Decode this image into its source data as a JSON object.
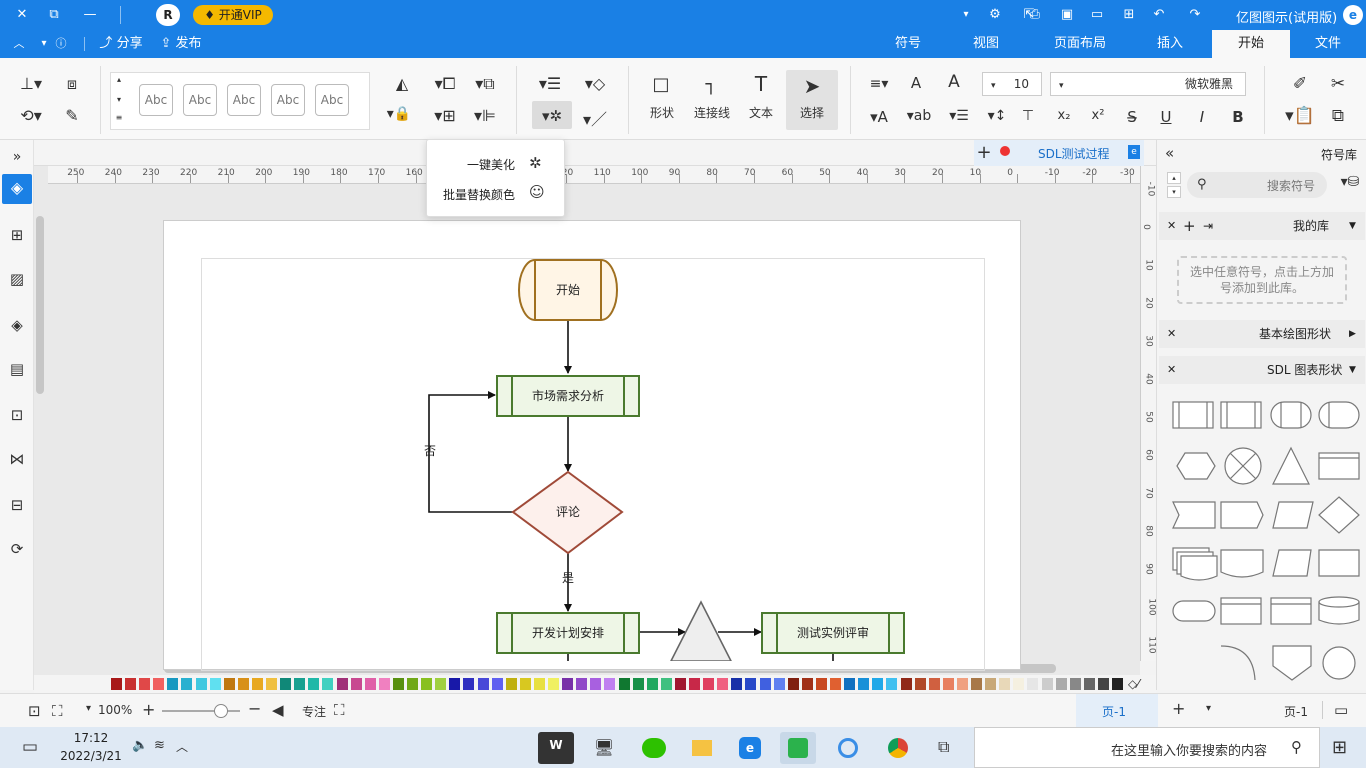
{
  "app": {
    "title": "亿图图示(试用版)"
  },
  "vip": {
    "label": "开通VIP",
    "avatar": "R"
  },
  "tabs": [
    "文件",
    "开始",
    "插入",
    "页面布局",
    "视图",
    "符号"
  ],
  "quick": {
    "share": "分享",
    "publish": "发布",
    "help": "?"
  },
  "ribbon": {
    "font_name": "微软雅黑",
    "font_size": "10",
    "select": "选择",
    "text": "文本",
    "connector": "连接线",
    "shape": "形状",
    "abc": "Abc"
  },
  "dropdown": {
    "items": [
      "一键美化",
      "批量替换颜色"
    ]
  },
  "doc_tab": {
    "name": "SDL测试过程"
  },
  "ruler": {
    "h_ticks": [
      "-30",
      "-20",
      "-10",
      "0",
      "10",
      "20",
      "30",
      "40",
      "50",
      "60",
      "70",
      "80",
      "90",
      "100",
      "110",
      "120",
      "130",
      "140",
      "150",
      "160",
      "170",
      "180",
      "190",
      "200",
      "210",
      "220",
      "230",
      "240",
      "250"
    ],
    "v_ticks": [
      "-10",
      "0",
      "10",
      "20",
      "30",
      "40",
      "50",
      "60",
      "70",
      "80",
      "90",
      "100",
      "110"
    ]
  },
  "flow": {
    "start": "开始",
    "market": "市场需求分析",
    "review": "评论",
    "no": "否",
    "yes": "是",
    "dev": "开发计划安排",
    "test": "测试实例评审"
  },
  "rightpanel": {
    "title": "符号库",
    "search_placeholder": "搜索符号",
    "mylib": "我的库",
    "mylib_hint": "选中任意符号，点击上方加号添加到此库。",
    "basic": "基本绘图形状",
    "sdl": "SDL 图表形状"
  },
  "status": {
    "page_sel": "页-1",
    "page_tab": "页-1",
    "focus": "专注",
    "zoom": "100%"
  },
  "taskbar": {
    "search": "在这里输入你要搜索的内容",
    "time": "17:12",
    "date": "2022/3/21"
  },
  "colors": {
    "accent": "#1a80e5",
    "vip": "#f5b800",
    "terminator_stroke": "#a07020",
    "terminator_fill": "#fff5e6",
    "process_stroke": "#4a7a2e",
    "process_fill": "#eef6e6",
    "decision_stroke": "#a04a38",
    "decision_fill": "#fdf0ec"
  },
  "palette": [
    "#222222",
    "#444444",
    "#666666",
    "#888888",
    "#aaaaaa",
    "#cccccc",
    "#e6e6e6",
    "#f5f0e0",
    "#e8d8b8",
    "#c8a878",
    "#a87848",
    "#f0a080",
    "#e88060",
    "#d06040",
    "#b04828",
    "#902818",
    "#40c0f0",
    "#20a8e8",
    "#1890d8",
    "#1070c0",
    "#e06030",
    "#c84820",
    "#a03018",
    "#802010",
    "#6080f0",
    "#4060e0",
    "#2848c8",
    "#1830a8",
    "#f06080",
    "#e04060",
    "#c82848",
    "#a01830",
    "#40c080",
    "#20a860",
    "#189048",
    "#107830",
    "#c080f0",
    "#a860e0",
    "#9048c8",
    "#7830a8",
    "#f0f060",
    "#e8e040",
    "#d8c820",
    "#c0b010",
    "#6060f0",
    "#4848d8",
    "#3030c0",
    "#1818a8",
    "#a0d040",
    "#88c020",
    "#70a818",
    "#589010",
    "#f080c0",
    "#e060a8",
    "#c84890",
    "#a03078",
    "#40d0c0",
    "#20b8a8",
    "#18a090",
    "#108878",
    "#f0c040",
    "#e8a820",
    "#d89018",
    "#c07810",
    "#60e0f0",
    "#40c8e0",
    "#28b0d0",
    "#1898c0",
    "#f06060",
    "#e04848",
    "#c83030",
    "#a81818"
  ]
}
